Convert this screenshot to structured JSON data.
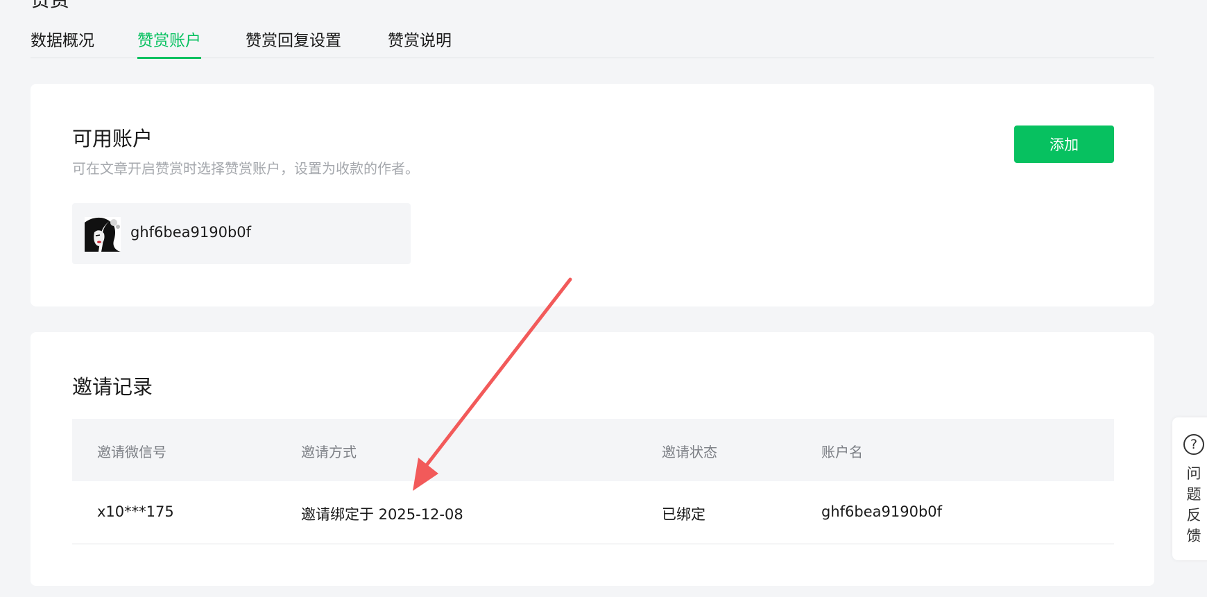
{
  "page": {
    "heading": "赞赏"
  },
  "tabs": [
    {
      "label": "数据概况",
      "active": false
    },
    {
      "label": "赞赏账户",
      "active": true
    },
    {
      "label": "赞赏回复设置",
      "active": false
    },
    {
      "label": "赞赏说明",
      "active": false
    }
  ],
  "accounts_card": {
    "title": "可用账户",
    "description": "可在文章开启赞赏时选择赞赏账户，设置为收款的作者。",
    "add_label": "添加",
    "accounts": [
      {
        "name": "ghf6bea9190b0f",
        "avatar_icon": "illustrated-woman-avatar"
      }
    ]
  },
  "invites_card": {
    "title": "邀请记录",
    "columns": [
      "邀请微信号",
      "邀请方式",
      "邀请状态",
      "账户名"
    ],
    "rows": [
      [
        "x10***175",
        "邀请绑定于 2025-12-08",
        "已绑定",
        "ghf6bea9190b0f"
      ]
    ]
  },
  "feedback": {
    "icon": "question-circle-icon",
    "label": "问题反馈"
  },
  "colors": {
    "accent": "#07c160",
    "background": "#f4f5f7",
    "annotation_arrow": "#f25a5a"
  }
}
